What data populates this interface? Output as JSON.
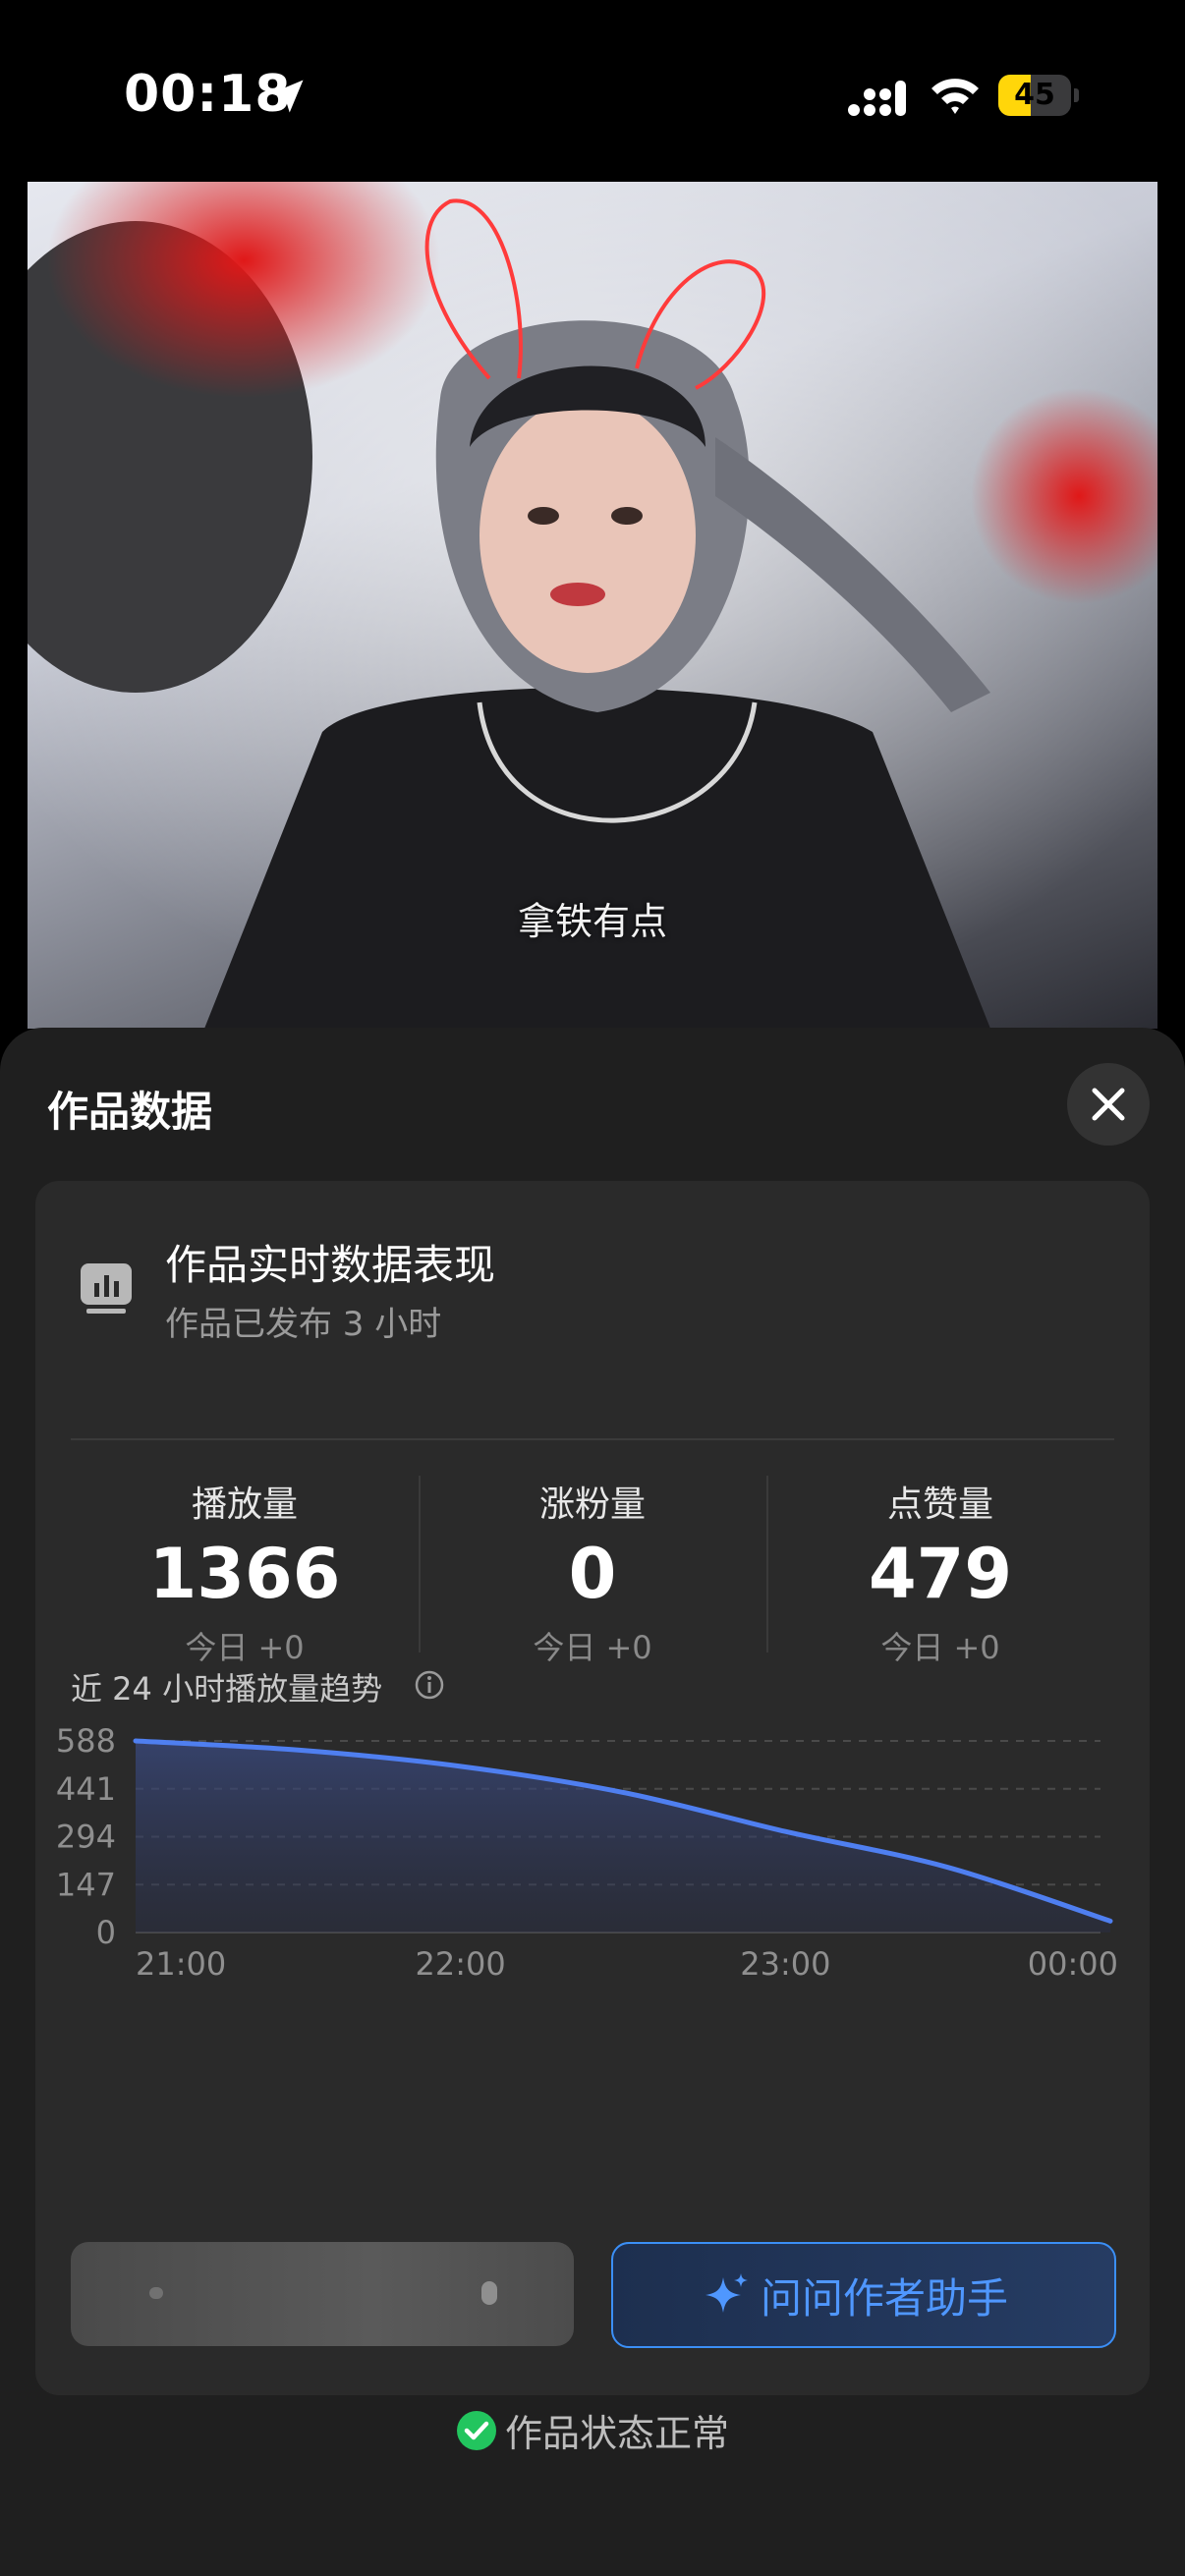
{
  "status_bar": {
    "time": "00:18",
    "battery": "45",
    "battery_level": 0.45
  },
  "photo": {
    "caption": "拿铁有点"
  },
  "sheet": {
    "title": "作品数据",
    "card": {
      "title": "作品实时数据表现",
      "subtitle": "作品已发布 3 小时"
    },
    "stats": [
      {
        "label": "播放量",
        "value": "1366",
        "today": "今日 +0"
      },
      {
        "label": "涨粉量",
        "value": "0",
        "today": "今日 +0"
      },
      {
        "label": "点赞量",
        "value": "479",
        "today": "今日 +0"
      }
    ],
    "trend_title": "近 24 小时播放量趋势",
    "ask_button": "问问作者助手",
    "status_text": "作品状态正常"
  },
  "colors": {
    "accent": "#4f7ff0",
    "success": "#22c55e",
    "ask_text": "#4f97ff"
  },
  "chart_data": {
    "type": "area",
    "x": [
      "21:00",
      "21:30",
      "22:00",
      "22:30",
      "23:00",
      "23:30",
      "00:00"
    ],
    "y": [
      588,
      560,
      510,
      430,
      310,
      200,
      35
    ],
    "x_ticks": [
      "21:00",
      "22:00",
      "23:00",
      "00:00"
    ],
    "y_ticks": [
      "588",
      "441",
      "294",
      "147",
      "0"
    ],
    "ylim": [
      0,
      588
    ],
    "grid": "dashed horizontal"
  }
}
